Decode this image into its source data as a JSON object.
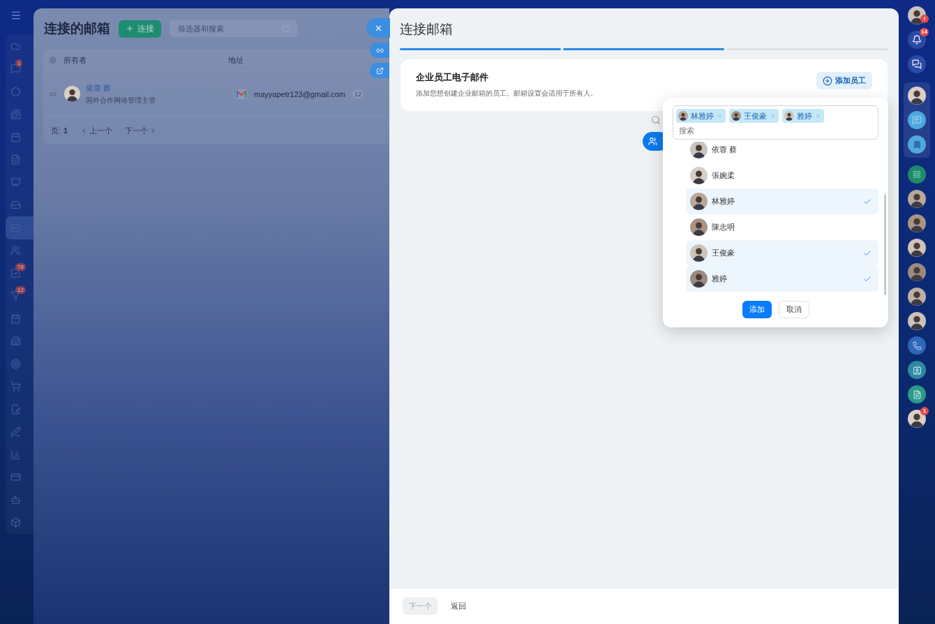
{
  "left_nav": {
    "items": [
      {
        "selected": false
      },
      {
        "selected": false,
        "badge": "1"
      },
      {
        "selected": false
      },
      {
        "selected": false
      },
      {
        "selected": false
      },
      {
        "selected": false
      },
      {
        "selected": false
      },
      {
        "selected": false
      },
      {
        "selected": true
      },
      {
        "selected": false
      },
      {
        "selected": false,
        "badge": "78"
      },
      {
        "selected": false,
        "badge": "12"
      },
      {
        "selected": false
      },
      {
        "selected": false
      },
      {
        "selected": false
      },
      {
        "selected": false
      },
      {
        "selected": false
      },
      {
        "selected": false
      },
      {
        "selected": false
      },
      {
        "selected": false
      },
      {
        "selected": false
      },
      {
        "selected": false
      }
    ]
  },
  "left_panel": {
    "title": "连接的邮箱",
    "connect_button": "连接",
    "search": {
      "placeholder": "筛选器和搜索"
    },
    "table": {
      "columns": [
        "所有者",
        "地址"
      ],
      "rows": [
        {
          "owner_name": "依蓉 蔡",
          "owner_title": "国外合作网络管理主管",
          "address": "mayyapetr123@gmail.com",
          "count": "12"
        }
      ]
    },
    "pagination": {
      "page_label": "页:",
      "page": "1",
      "prev": "上一个",
      "next": "下一个"
    }
  },
  "right_panel": {
    "title": "连接邮箱",
    "steps": [
      {
        "done": true
      },
      {
        "done": true
      },
      {
        "done": false
      }
    ],
    "card": {
      "title": "企业员工电子邮件",
      "description": "添加您想创建企业邮箱的员工。邮箱设置会适用于所有人。",
      "add_button": "添加员工"
    },
    "picker": {
      "tags": [
        {
          "name": "林雅婷"
        },
        {
          "name": "王俊豪"
        },
        {
          "name": "雅婷"
        }
      ],
      "placeholder": "搜索",
      "options": [
        {
          "name": "依蓉 蔡",
          "selected": false
        },
        {
          "name": "張婉柔",
          "selected": false
        },
        {
          "name": "林雅婷",
          "selected": true
        },
        {
          "name": "陳志明",
          "selected": false
        },
        {
          "name": "王俊豪",
          "selected": true
        },
        {
          "name": "雅婷",
          "selected": true
        }
      ],
      "add_button": "添加",
      "cancel_button": "取消"
    },
    "footer": {
      "next_button": {
        "label": "下一个",
        "disabled": true
      },
      "back_button": "返回"
    }
  },
  "right_bar": {
    "items": [
      {
        "kind": "avatar",
        "badge": "!"
      },
      {
        "kind": "bell",
        "badge": "14"
      },
      {
        "kind": "chat"
      }
    ],
    "group": [
      {
        "kind": "avatar"
      },
      {
        "kind": "message"
      },
      {
        "kind": "bookmark"
      }
    ],
    "apps": [
      {
        "kind": "app"
      },
      {
        "kind": "avatar"
      },
      {
        "kind": "avatar"
      },
      {
        "kind": "avatar"
      },
      {
        "kind": "avatar"
      },
      {
        "kind": "avatar"
      },
      {
        "kind": "avatar"
      },
      {
        "kind": "phone"
      },
      {
        "kind": "contact"
      },
      {
        "kind": "document"
      },
      {
        "kind": "avatar",
        "badge": "1"
      }
    ]
  }
}
